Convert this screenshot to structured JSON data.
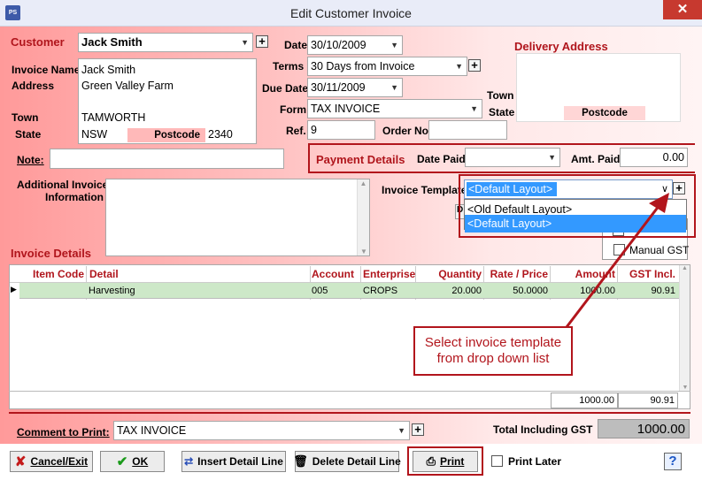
{
  "window": {
    "title": "Edit Customer Invoice",
    "app_icon": "PS"
  },
  "customer": {
    "label": "Customer",
    "value": "Jack Smith",
    "invoice_name_label": "Invoice Name",
    "address_label": "Address",
    "town_label": "Town",
    "state_label": "State",
    "invoice_name": "Jack Smith",
    "address": "Green Valley Farm",
    "town": "TAMWORTH",
    "state": "NSW",
    "postcode_label": "Postcode",
    "postcode": "2340"
  },
  "dates": {
    "date_label": "Date",
    "date": "30/10/2009",
    "terms_label": "Terms",
    "terms": "30 Days from Invoice",
    "due_label": "Due Date",
    "due": "30/11/2009",
    "form_label": "Form",
    "form": "TAX INVOICE",
    "ref_label": "Ref.",
    "ref": "9",
    "order_label": "Order No.",
    "order": ""
  },
  "delivery": {
    "title": "Delivery Address",
    "town_label": "Town",
    "state_label": "State",
    "postcode_label": "Postcode"
  },
  "note": {
    "label": "Note:",
    "value": ""
  },
  "payment": {
    "title": "Payment Details",
    "date_paid_label": "Date Paid",
    "date_paid": "",
    "amt_paid_label": "Amt. Paid",
    "amt_paid": "0.00"
  },
  "additional": {
    "label_line1": "Additional Invoice",
    "label_line2": "Information",
    "value": ""
  },
  "template": {
    "label": "Invoice Template",
    "selected": "<Default Layout>",
    "options": [
      "<Old Default Layout>",
      "<Default Layout>"
    ]
  },
  "manual_gst": {
    "label": "Manual GST"
  },
  "details": {
    "title": "Invoice Details",
    "columns": [
      "Item Code",
      "Detail",
      "Account",
      "Enterprise",
      "Quantity",
      "Rate / Price",
      "Amount",
      "GST Incl."
    ],
    "rows": [
      {
        "item_code": "",
        "detail": "Harvesting",
        "account": "005",
        "enterprise": "CROPS",
        "quantity": "20.000",
        "rate": "50.0000",
        "amount": "1000.00",
        "gst": "90.91"
      }
    ],
    "total_amount": "1000.00",
    "total_gst": "90.91"
  },
  "callout": {
    "text": "Select invoice template from drop down list"
  },
  "comment": {
    "label": "Comment to Print:",
    "value": "TAX INVOICE"
  },
  "total": {
    "label": "Total Including GST",
    "value": "1000.00"
  },
  "buttons": {
    "cancel": "Cancel/Exit",
    "ok": "OK",
    "insert": "Insert Detail Line",
    "delete": "Delete Detail Line",
    "print": "Print",
    "print_later": "Print Later",
    "help": "?"
  },
  "colors": {
    "accent_red": "#b0151c",
    "selection_blue": "#3399ff",
    "row_green": "#cde8c8",
    "annotation_red": "#b2151c"
  }
}
